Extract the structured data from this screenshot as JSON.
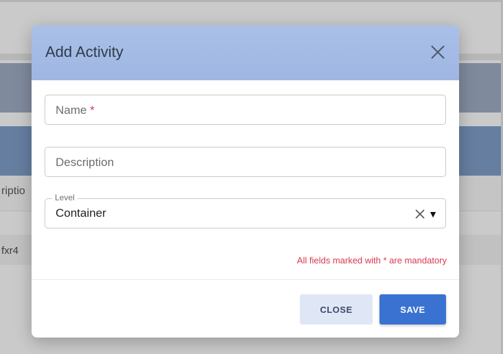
{
  "background": {
    "column_header_fragment": "riptio",
    "row_fragment": "fxr4"
  },
  "dialog": {
    "title": "Add Activity",
    "fields": {
      "name_placeholder": "Name",
      "required_marker": "*",
      "description_placeholder": "Description",
      "level_label": "Level",
      "level_value": "Container"
    },
    "mandatory_note": "All fields marked with * are mandatory",
    "buttons": {
      "close_label": "CLOSE",
      "save_label": "SAVE"
    },
    "icons": {
      "close": "close-icon",
      "clear": "clear-icon",
      "dropdown": "dropdown-arrow-icon"
    },
    "colors": {
      "header": "#a9c0e8",
      "save_button": "#3a72d2",
      "close_button": "#dfe7f6",
      "required": "#d9374f"
    }
  }
}
